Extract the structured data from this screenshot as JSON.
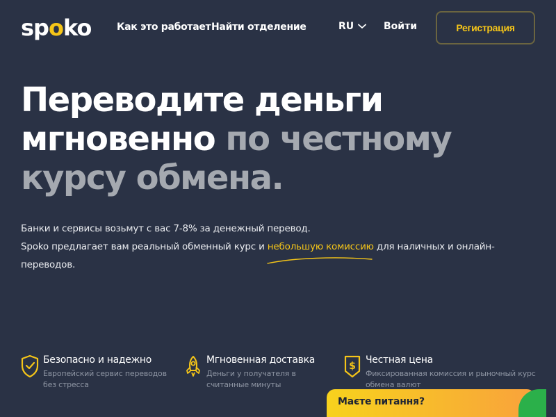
{
  "header": {
    "logo": {
      "pre": "sp",
      "accent": "o",
      "post": "ko"
    },
    "nav": [
      "Как это работает",
      "Найти отделение"
    ],
    "language": "RU",
    "login": "Войти",
    "register": "Регистрация"
  },
  "hero": {
    "title_line1": "Переводите деньги",
    "title_line2_bold": "мгновенно",
    "title_line2_muted": " по честному",
    "title_line3_muted": "курсу обмена",
    "title_end": ".",
    "desc_line1": "Банки и сервисы возьмут с вас 7-8% за денежный перевод.",
    "desc_line2_pre": "Spoko предлагает вам реальный обменный курс и ",
    "desc_line2_highlight": "небольшую комиссию",
    "desc_line2_post": " для наличных и онлайн-переводов."
  },
  "features": [
    {
      "icon": "shield-check-icon",
      "title": "Безопасно и надежно",
      "desc": "Европейский сервис переводов без стресса"
    },
    {
      "icon": "rocket-icon",
      "title": "Мгновенная доставка",
      "desc": "Деньги у получателя в считанные минуты"
    },
    {
      "icon": "price-tag-dollar-icon",
      "title": "Честная цена",
      "desc": "Фиксированная комиссия и рыночный курс обмена валют"
    }
  ],
  "chat": {
    "label": "Маєте питання?"
  },
  "colors": {
    "background": "#2a3245",
    "accent": "#f5c518",
    "muted_text": "#a5a9b0",
    "chat_badge": "#2bb04a"
  }
}
